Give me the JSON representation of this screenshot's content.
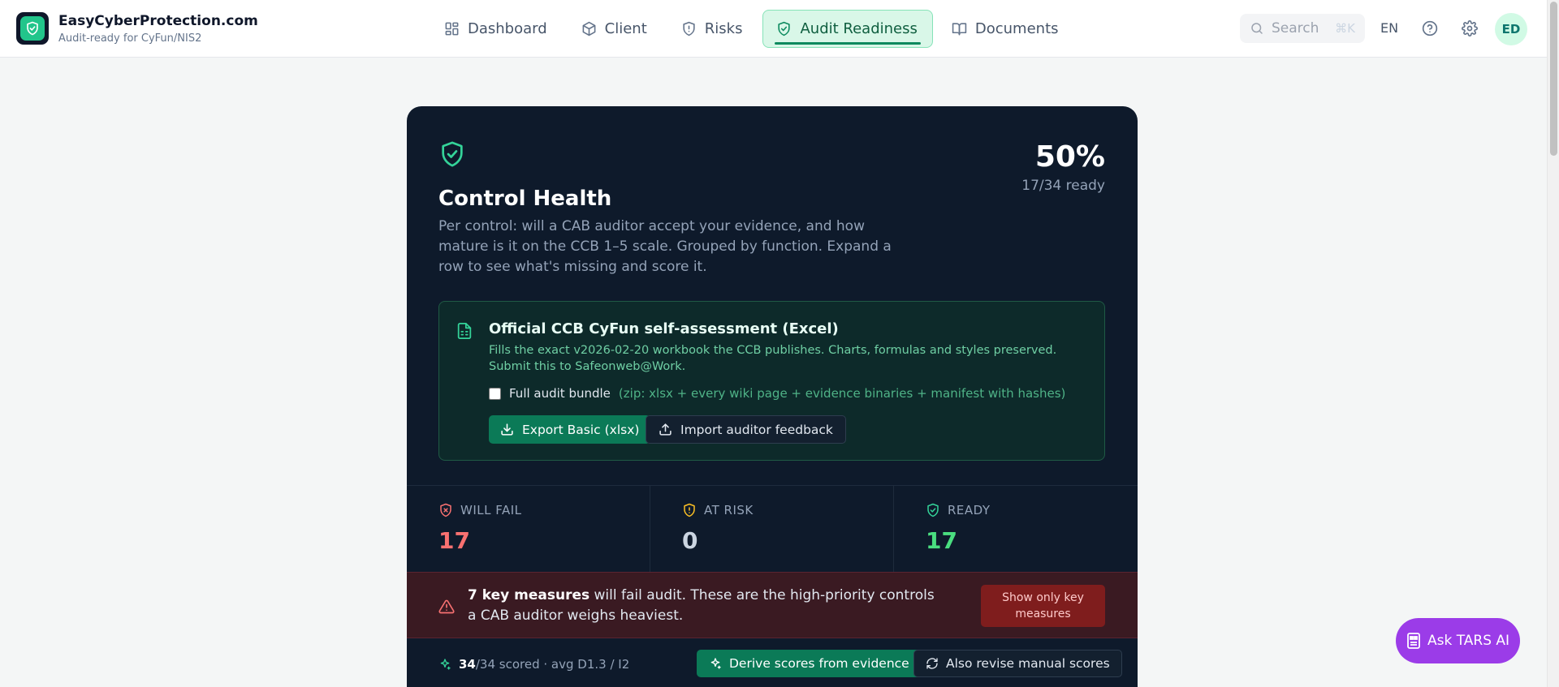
{
  "brand": {
    "name": "EasyCyberProtection.com",
    "tagline": "Audit-ready for CyFun/NIS2",
    "logo_icon": "shield-check-icon"
  },
  "nav": {
    "items": [
      {
        "label": "Dashboard",
        "icon": "dashboard-grid-icon",
        "active": false
      },
      {
        "label": "Client",
        "icon": "cube-icon",
        "active": false
      },
      {
        "label": "Risks",
        "icon": "shield-alert-icon",
        "active": false
      },
      {
        "label": "Audit Readiness",
        "icon": "shield-check-icon",
        "active": true
      },
      {
        "label": "Documents",
        "icon": "book-open-icon",
        "active": false
      }
    ]
  },
  "search": {
    "placeholder": "Search",
    "shortcut": "⌘K"
  },
  "header": {
    "language": "EN",
    "user_initials": "ED"
  },
  "control_health": {
    "title": "Control Health",
    "description": "Per control: will a CAB auditor accept your evidence, and how mature is it on the CCB 1–5 scale. Grouped by function. Expand a row to see what's missing and score it.",
    "percent": "50%",
    "ready_summary": "17/34 ready"
  },
  "ccb_export": {
    "title": "Official CCB CyFun self-assessment (Excel)",
    "description": "Fills the exact v2026-02-20 workbook the CCB publishes. Charts, formulas and styles preserved. Submit this to Safeonweb@Work.",
    "bundle_label": "Full audit bundle",
    "bundle_hint": "(zip: xlsx + every wiki page + evidence binaries + manifest with hashes)",
    "bundle_checked": false,
    "export_button": "Export Basic (xlsx)",
    "import_button": "Import auditor feedback"
  },
  "stats": {
    "will_fail": {
      "label": "WILL FAIL",
      "value": "17",
      "color": "#f87171"
    },
    "at_risk": {
      "label": "AT RISK",
      "value": "0",
      "color": "#fbbf24"
    },
    "ready": {
      "label": "READY",
      "value": "17",
      "color": "#4ade80"
    }
  },
  "alert": {
    "bold": "7 key measures",
    "text": " will fail audit. These are the high-priority controls a CAB auditor weighs heaviest.",
    "button": "Show only key measures"
  },
  "scoring": {
    "scored": "34",
    "rest": "/34 scored · avg D1.3 / I2",
    "derive_button": "Derive scores from evidence",
    "revise_button": "Also revise manual scores"
  },
  "assistant": {
    "label": "Ask TARS AI"
  }
}
